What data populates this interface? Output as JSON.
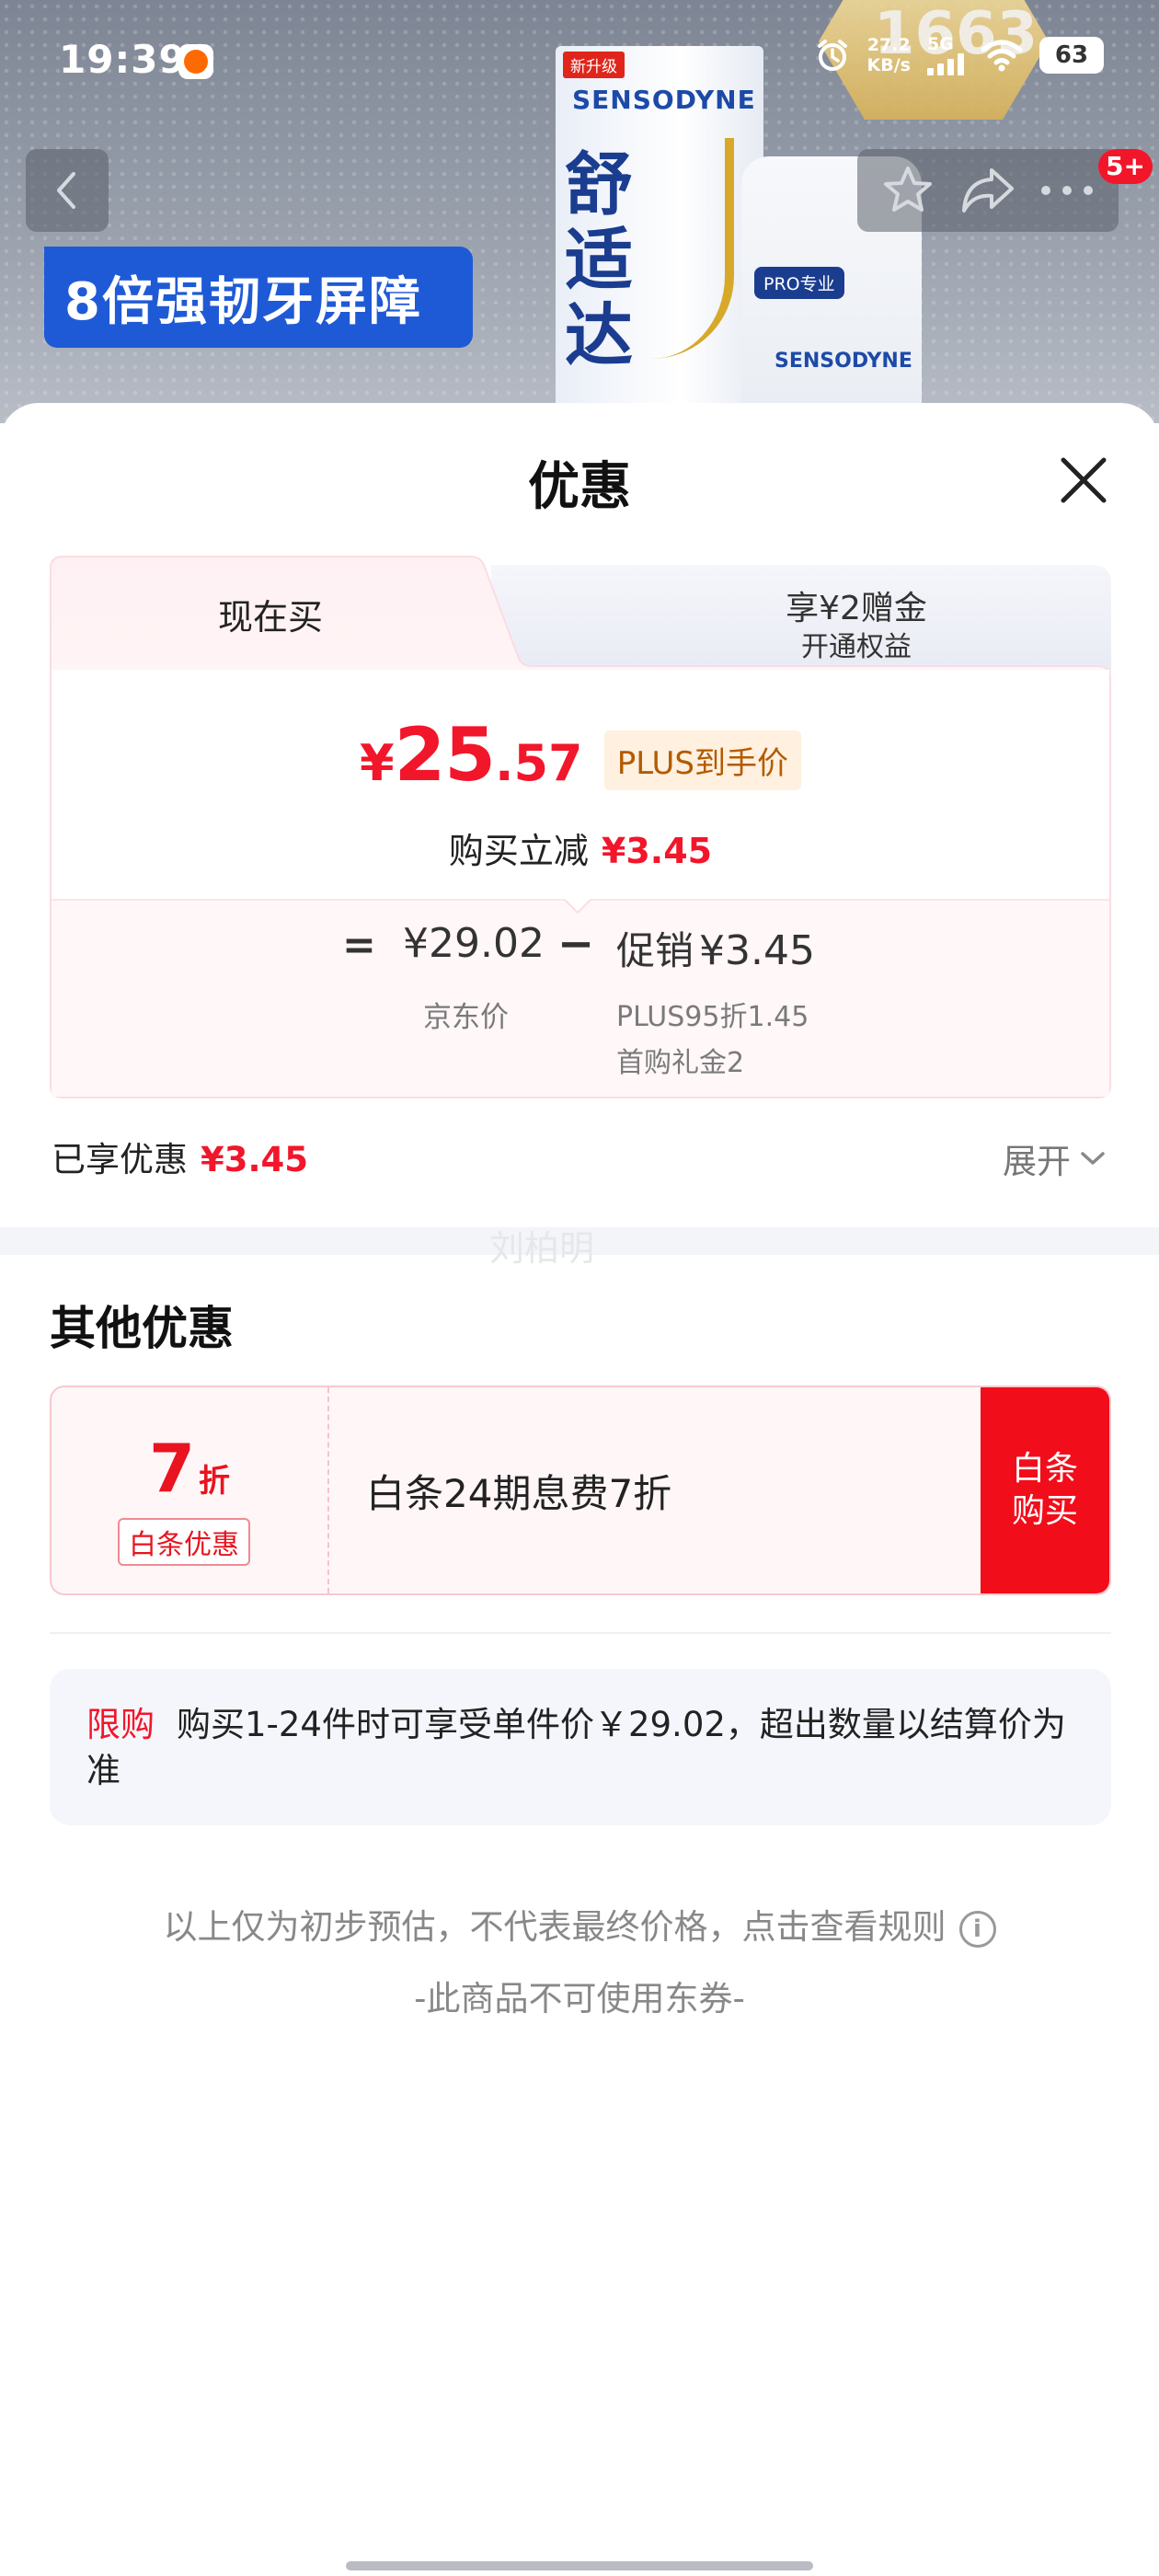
{
  "status_bar": {
    "time": "19:39",
    "net_speed_value": "27.2",
    "net_speed_unit": "KB/s",
    "network": "5G",
    "battery": "63"
  },
  "banner": {
    "badge_count": "5+",
    "promo_text": "8倍强韧牙屏障",
    "product_tag": "新升级",
    "product_brand": "SENSODYNE",
    "product_name": "舒适达",
    "tube_badge": "PRO专业",
    "tube_brand": "SENSODYNE",
    "hex_badge": "1663"
  },
  "sheet": {
    "title": "优惠",
    "tabs": [
      {
        "label": "现在买"
      },
      {
        "label": "享¥2赠金",
        "sublabel": "开通权益"
      }
    ],
    "price": {
      "symbol": "¥",
      "integer": "25",
      "decimal": ".57",
      "tag": "PLUS到手价"
    },
    "instant_reduce": {
      "label": "购买立减",
      "amount": "¥3.45"
    },
    "formula": {
      "equals": "=",
      "jd_price": "¥29.02",
      "jd_price_label": "京东价",
      "minus": "−",
      "promo_label": "促销",
      "promo_amount": "¥3.45",
      "promo_details": [
        "PLUS95折1.45",
        "首购礼金2"
      ]
    },
    "enjoyed": {
      "label": "已享优惠",
      "amount": "¥3.45",
      "expand_label": "展开"
    },
    "watermark": "刘柏明",
    "other_section": {
      "title": "其他优惠",
      "coupon": {
        "discount_value": "7",
        "discount_unit": "折",
        "tag": "白条优惠",
        "description": "白条24期息费7折",
        "button_label": "白条购买"
      }
    },
    "limit": {
      "label": "限购",
      "text": "购买1-24件时可享受单件价￥29.02，超出数量以结算价为准"
    },
    "note": "以上仅为初步预估，不代表最终价格，点击查看规则",
    "note_icon": "i",
    "note2": "-此商品不可使用东券-"
  },
  "colors": {
    "accent_red": "#f2162b",
    "plus_tag_bg": "#fff0df",
    "plus_tag_text": "#b25b00",
    "card_border": "#fadde2"
  }
}
